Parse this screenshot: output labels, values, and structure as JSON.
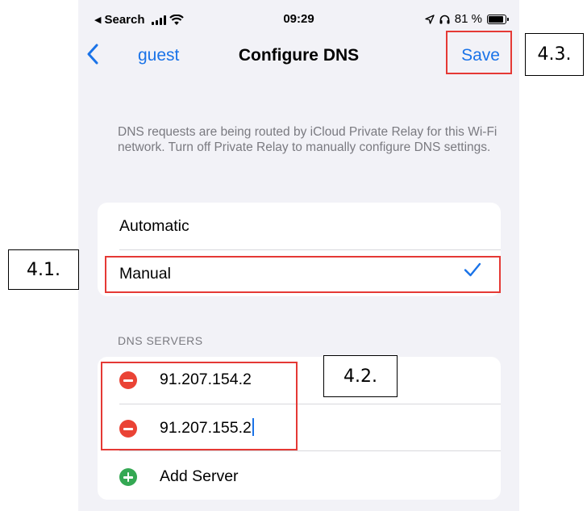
{
  "status_bar": {
    "back_app": "Search",
    "time": "09:29",
    "battery": "81 %"
  },
  "nav": {
    "back_label": "guest",
    "title": "Configure DNS",
    "save_label": "Save"
  },
  "note": "DNS requests are being routed by iCloud Private Relay for this Wi-Fi network. Turn off Private Relay to manually configure DNS settings.",
  "mode": {
    "options": [
      "Automatic",
      "Manual"
    ],
    "selected": "Manual"
  },
  "dns_servers": {
    "header": "DNS SERVERS",
    "servers": [
      "91.207.154.2",
      "91.207.155.2"
    ],
    "add_label": "Add Server"
  },
  "callouts": {
    "manual": "4.1.",
    "servers": "4.2.",
    "save": "4.3."
  },
  "colors": {
    "accent": "#1a73e8",
    "remove": "#ea4335",
    "add": "#34a853",
    "highlight": "#e53935",
    "background": "#f2f2f7"
  },
  "icons": [
    "back-chevron-icon",
    "signal-icon",
    "wifi-icon",
    "location-icon",
    "headphones-icon",
    "battery-icon",
    "checkmark-icon",
    "remove-icon",
    "add-icon"
  ]
}
